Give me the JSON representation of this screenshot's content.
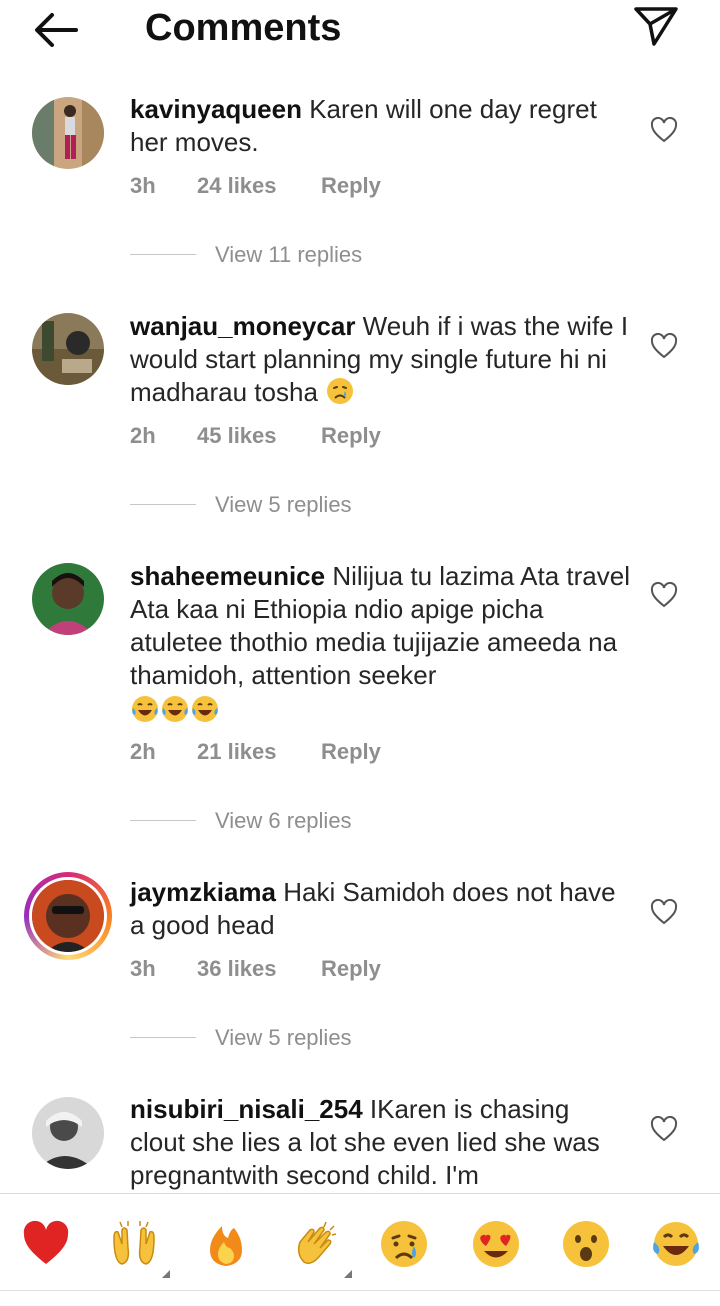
{
  "header": {
    "title": "Comments",
    "back_icon": "arrow-left-icon",
    "share_icon": "paper-plane-icon"
  },
  "comments": [
    {
      "username": "kavinyaqueen",
      "text": "Karen will one day regret her moves.",
      "time": "3h",
      "likes": "24 likes",
      "reply": "Reply",
      "view_replies": "View 11 replies",
      "has_story_ring": false
    },
    {
      "username": "wanjau_moneycar",
      "text": "Weuh if i was the wife I would start planning my single future hi ni madharau tosha",
      "emoji": "crying-face",
      "time": "2h",
      "likes": "45 likes",
      "reply": "Reply",
      "view_replies": "View 5 replies",
      "has_story_ring": false
    },
    {
      "username": "shaheemeunice",
      "text": "Nilijua tu lazima Ata travel Ata kaa ni Ethiopia ndio apige picha atuletee thothio media tujijazie ameeda na thamidoh, attention seeker",
      "emoji": "tears-of-joy x3",
      "time": "2h",
      "likes": "21 likes",
      "reply": "Reply",
      "view_replies": "View 6 replies",
      "has_story_ring": false
    },
    {
      "username": "jaymzkiama",
      "text": "Haki Samidoh does not have a good head",
      "time": "3h",
      "likes": "36 likes",
      "reply": "Reply",
      "view_replies": "View 5 replies",
      "has_story_ring": true
    },
    {
      "username": "nisubiri_nisali_254",
      "text": "IKaren is chasing clout she lies a lot she even lied she was pregnantwith second child. I'm",
      "has_story_ring": false
    }
  ],
  "reactions": [
    "red-heart",
    "raising-hands",
    "fire",
    "clapping-hands",
    "crying-face",
    "heart-eyes",
    "surprised-face",
    "tears-of-joy"
  ],
  "colors": {
    "text": "#262626",
    "muted": "#8e8e8e",
    "heart_red": "#e02424"
  }
}
